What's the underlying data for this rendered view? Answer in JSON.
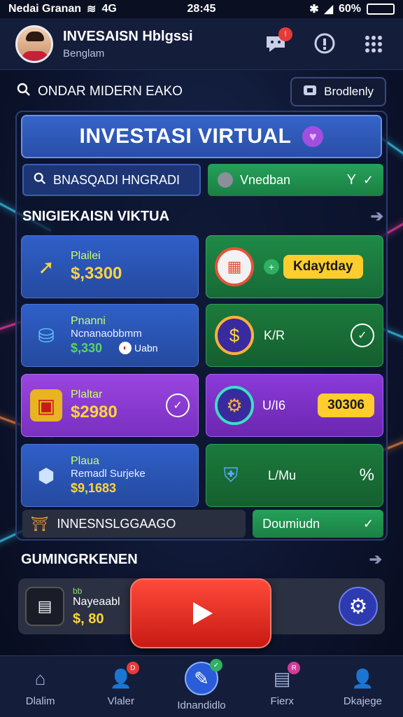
{
  "status": {
    "carrier": "Nedai Granan",
    "network": "4G",
    "time": "28:45",
    "battery": "60%",
    "battery_fill": 0.8
  },
  "header": {
    "title": "INVESAISN Hblgssi",
    "subtitle": "Benglam"
  },
  "search": {
    "label": "ONDAR MIDERN EAKO",
    "button": "Brodlenly"
  },
  "hero": {
    "title": "INVESTASI VIRTUAL"
  },
  "row2": {
    "left": "BNASQADI HNGRADI",
    "right": "Vnedban",
    "right_value": "Y"
  },
  "section1": {
    "title": "SNIGIEKAISN VIKTUA"
  },
  "cards": [
    {
      "label": "Plailei",
      "value": "$,3300"
    },
    {
      "pill": "Kdaytday"
    },
    {
      "label": "Pnanni",
      "sub": "Ncnanaobbmm",
      "value": "$,330",
      "tag": "Uabn"
    },
    {
      "label": "K/R"
    },
    {
      "label": "Plaltar",
      "value": "$2980"
    },
    {
      "label": "U/I6",
      "pill": "30306"
    },
    {
      "label": "Plaua",
      "sub": "Remadl Surjeke",
      "value": "$9,1683"
    },
    {
      "label": "L/Mu",
      "value": "%"
    }
  ],
  "rowbottom": {
    "left": "INNESNSLGGAAGO",
    "right": "Doumiudn"
  },
  "section2": {
    "title": "GUMINGRKENEN"
  },
  "promo": {
    "l1": "bb",
    "l2": "Nayeaabl",
    "l3": "$, 80"
  },
  "nav": [
    {
      "label": "Dlalim",
      "badge": ""
    },
    {
      "label": "Vlaler",
      "badge": "D"
    },
    {
      "label": "Idnandidlo",
      "badge": "✓"
    },
    {
      "label": "Fierx",
      "badge": "R"
    },
    {
      "label": "Dkajege",
      "badge": ""
    }
  ],
  "colors": {
    "accent": "#2a5bd8",
    "green": "#1f8a47",
    "purple": "#8b3ad8",
    "gold": "#ffd43a"
  }
}
